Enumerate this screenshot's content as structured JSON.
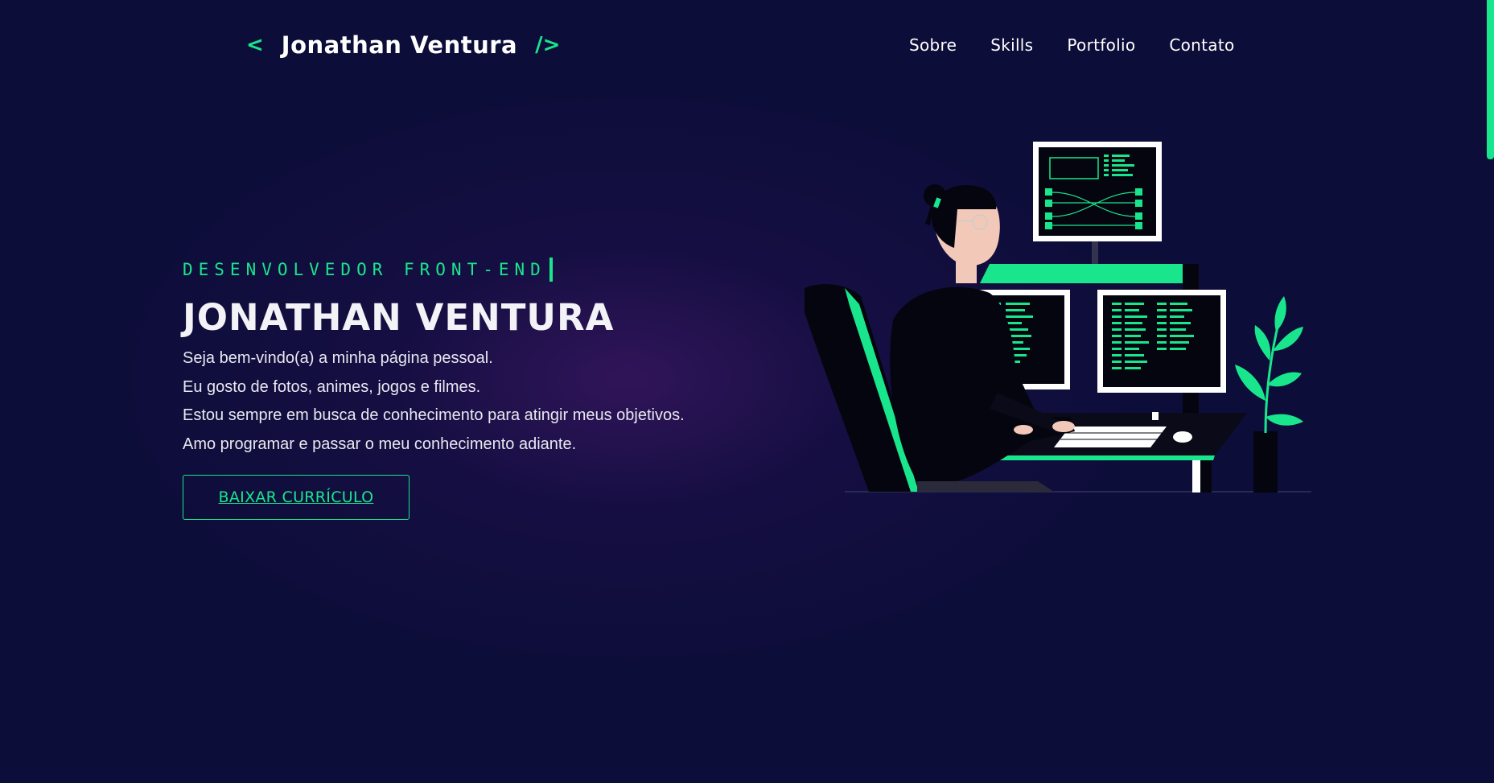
{
  "header": {
    "logo_open": "<",
    "logo_name": "Jonathan Ventura",
    "logo_close": "/>"
  },
  "nav": {
    "items": [
      {
        "label": "Sobre"
      },
      {
        "label": "Skills"
      },
      {
        "label": "Portfolio"
      },
      {
        "label": "Contato"
      }
    ]
  },
  "hero": {
    "role": "DESENVOLVEDOR FRONT-END",
    "title": "JONATHAN VENTURA",
    "lines": [
      "Seja bem-vindo(a) a minha página pessoal.",
      "Eu gosto de fotos, animes, jogos e filmes.",
      "Estou sempre em busca de conhecimento para atingir meus objetivos.",
      "Amo programar e passar o meu conhecimento adiante."
    ],
    "cta_label": "BAIXAR CURRÍCULO"
  },
  "illustration": {
    "icon": "developer-at-desk-illustration"
  },
  "colors": {
    "background": "#0d0d3a",
    "accent": "#19e68c",
    "text": "#ffffff"
  }
}
